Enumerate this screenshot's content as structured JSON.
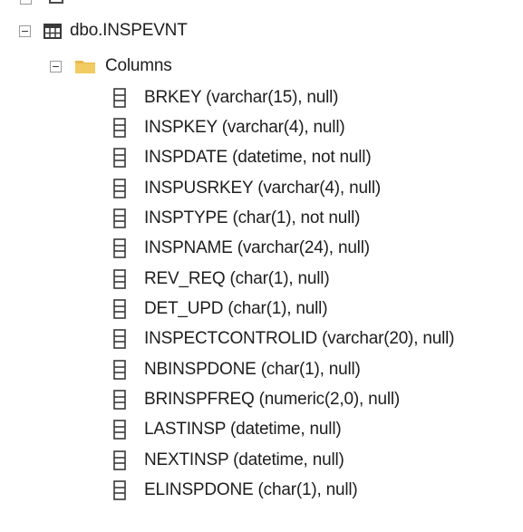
{
  "tree": {
    "table": {
      "icon": "table-icon",
      "label": "dbo.INSPEVNT",
      "expander_icon": "collapse-icon"
    },
    "columns_folder": {
      "icon": "folder-icon",
      "label": "Columns",
      "expander_icon": "collapse-icon",
      "folder_color": "#e8b84a"
    },
    "columns": [
      {
        "icon": "column-icon",
        "label": "BRKEY (varchar(15), null)"
      },
      {
        "icon": "column-icon",
        "label": "INSPKEY (varchar(4), null)"
      },
      {
        "icon": "column-icon",
        "label": "INSPDATE (datetime, not null)"
      },
      {
        "icon": "column-icon",
        "label": "INSPUSRKEY (varchar(4), null)"
      },
      {
        "icon": "column-icon",
        "label": "INSPTYPE (char(1), not null)"
      },
      {
        "icon": "column-icon",
        "label": "INSPNAME (varchar(24), null)"
      },
      {
        "icon": "column-icon",
        "label": "REV_REQ (char(1), null)"
      },
      {
        "icon": "column-icon",
        "label": "DET_UPD (char(1), null)"
      },
      {
        "icon": "column-icon",
        "label": "INSPECTCONTROLID (varchar(20), null)"
      },
      {
        "icon": "column-icon",
        "label": "NBINSPDONE (char(1), null)"
      },
      {
        "icon": "column-icon",
        "label": "BRINSPFREQ (numeric(2,0), null)"
      },
      {
        "icon": "column-icon",
        "label": "LASTINSP (datetime, null)"
      },
      {
        "icon": "column-icon",
        "label": "NEXTINSP (datetime, null)"
      },
      {
        "icon": "column-icon",
        "label": "ELINSPDONE (char(1), null)"
      }
    ]
  }
}
